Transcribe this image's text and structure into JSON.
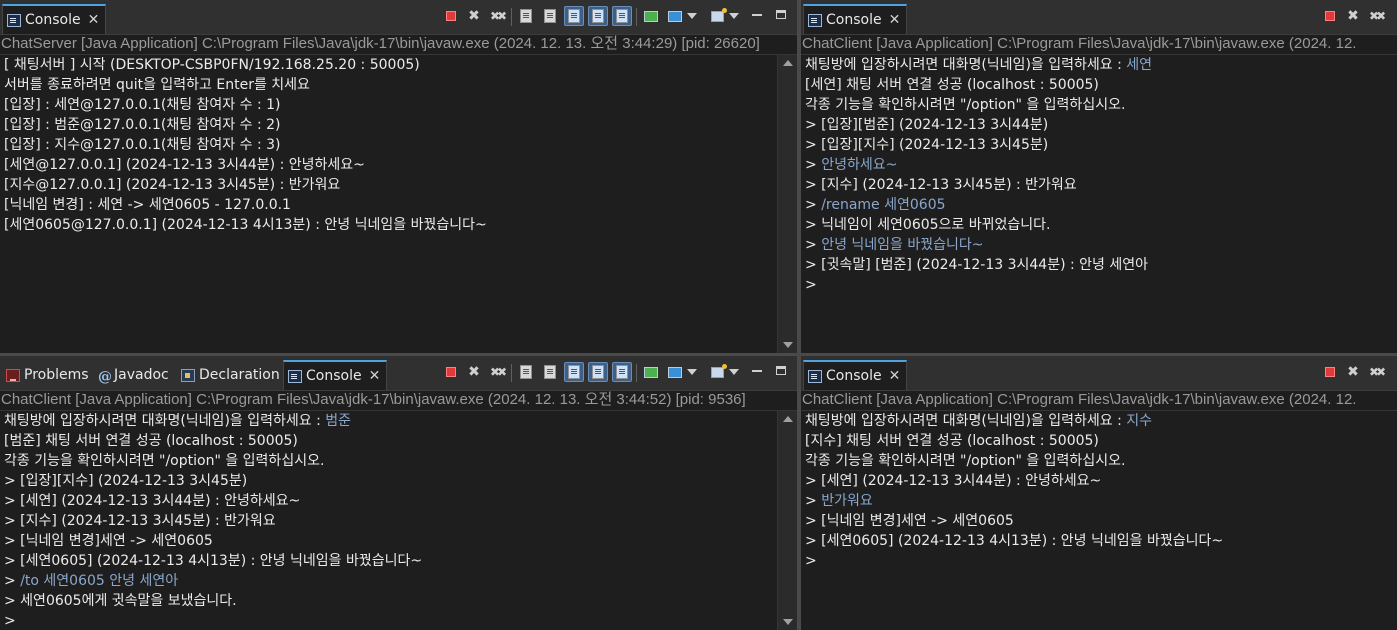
{
  "panes": [
    {
      "tabs": [
        {
          "icon": "console-icon",
          "label": "Console",
          "closable": true,
          "active": true
        }
      ],
      "description": "ChatServer [Java Application] C:\\Program Files\\Java\\jdk-17\\bin\\javaw.exe  (2024. 12. 13. 오전 3:44:29) [pid: 26620]",
      "lines": [
        {
          "prefix": "[ 채팅서버 ] 시작 (DESKTOP-CSBP0FN/192.168.25.20 : 50005)",
          "input": ""
        },
        {
          "prefix": "서버를 종료하려면 quit을 입력하고 Enter를 치세요",
          "input": ""
        },
        {
          "prefix": "[입장] : 세연@127.0.0.1(채팅 참여자 수 : 1)",
          "input": ""
        },
        {
          "prefix": "[입장] : 범준@127.0.0.1(채팅 참여자 수 : 2)",
          "input": ""
        },
        {
          "prefix": "[입장] : 지수@127.0.0.1(채팅 참여자 수 : 3)",
          "input": ""
        },
        {
          "prefix": "[세연@127.0.0.1] (2024-12-13 3시44분) : 안녕하세요~",
          "input": ""
        },
        {
          "prefix": "[지수@127.0.0.1] (2024-12-13 3시45분) : 반가워요",
          "input": ""
        },
        {
          "prefix": "[닉네임 변경] : 세연 -> 세연0605 - 127.0.0.1",
          "input": ""
        },
        {
          "prefix": "[세연0605@127.0.0.1] (2024-12-13 4시13분) : 안녕 닉네임을 바꿨습니다~",
          "input": ""
        }
      ]
    },
    {
      "tabs": [
        {
          "icon": "console-icon",
          "label": "Console",
          "closable": true,
          "active": true
        }
      ],
      "description": "ChatClient [Java Application] C:\\Program Files\\Java\\jdk-17\\bin\\javaw.exe  (2024. 12.",
      "lines": [
        {
          "prefix": "채팅방에 입장하시려면 대화명(닉네임)을 입력하세요 : ",
          "input": "세연"
        },
        {
          "prefix": "[세연] 채팅 서버 연결 성공 (localhost : 50005)",
          "input": ""
        },
        {
          "prefix": "각종 기능을 확인하시려면 \"/option\" 을 입력하십시오.",
          "input": ""
        },
        {
          "prefix": "> [입장][범준] (2024-12-13 3시44분)",
          "input": ""
        },
        {
          "prefix": "> [입장][지수] (2024-12-13 3시45분)",
          "input": ""
        },
        {
          "prefix": "> ",
          "input": "안녕하세요~"
        },
        {
          "prefix": "> [지수] (2024-12-13 3시45분) : 반가워요",
          "input": ""
        },
        {
          "prefix": "> ",
          "input": "/rename 세연0605"
        },
        {
          "prefix": "> 닉네임이 세연0605으로 바뀌었습니다.",
          "input": ""
        },
        {
          "prefix": "> ",
          "input": "안녕 닉네임을 바꿨습니다~"
        },
        {
          "prefix": "> [귓속말] [범준] (2024-12-13 3시44분) : 안녕 세연아",
          "input": ""
        },
        {
          "prefix": ">",
          "input": ""
        }
      ]
    },
    {
      "tabs": [
        {
          "icon": "problems-icon",
          "label": "Problems",
          "closable": false,
          "active": false
        },
        {
          "icon": "javadoc-icon",
          "label": "Javadoc",
          "closable": false,
          "active": false
        },
        {
          "icon": "declaration-icon",
          "label": "Declaration",
          "closable": false,
          "active": false
        },
        {
          "icon": "console-icon",
          "label": "Console",
          "closable": true,
          "active": true
        }
      ],
      "description": "ChatClient [Java Application] C:\\Program Files\\Java\\jdk-17\\bin\\javaw.exe  (2024. 12. 13. 오전 3:44:52) [pid: 9536]",
      "lines": [
        {
          "prefix": "채팅방에 입장하시려면 대화명(닉네임)을 입력하세요 : ",
          "input": "범준"
        },
        {
          "prefix": "[범준] 채팅 서버 연결 성공 (localhost : 50005)",
          "input": ""
        },
        {
          "prefix": "각종 기능을 확인하시려면 \"/option\" 을 입력하십시오.",
          "input": ""
        },
        {
          "prefix": "> [입장][지수] (2024-12-13 3시45분)",
          "input": ""
        },
        {
          "prefix": "> [세연] (2024-12-13 3시44분) : 안녕하세요~",
          "input": ""
        },
        {
          "prefix": "> [지수] (2024-12-13 3시45분) : 반가워요",
          "input": ""
        },
        {
          "prefix": "> [닉네임 변경]세연 -> 세연0605",
          "input": ""
        },
        {
          "prefix": "> [세연0605] (2024-12-13 4시13분) : 안녕 닉네임을 바꿨습니다~",
          "input": ""
        },
        {
          "prefix": "> ",
          "input": "/to 세연0605 안녕 세연아"
        },
        {
          "prefix": "> 세연0605에게 귓속말을 보냈습니다.",
          "input": ""
        },
        {
          "prefix": ">",
          "input": ""
        }
      ]
    },
    {
      "tabs": [
        {
          "icon": "console-icon",
          "label": "Console",
          "closable": true,
          "active": true
        }
      ],
      "description": "ChatClient [Java Application] C:\\Program Files\\Java\\jdk-17\\bin\\javaw.exe  (2024. 12.",
      "lines": [
        {
          "prefix": "채팅방에 입장하시려면 대화명(닉네임)을 입력하세요 : ",
          "input": "지수"
        },
        {
          "prefix": "[지수] 채팅 서버 연결 성공 (localhost : 50005)",
          "input": ""
        },
        {
          "prefix": "각종 기능을 확인하시려면 \"/option\" 을 입력하십시오.",
          "input": ""
        },
        {
          "prefix": "> [세연] (2024-12-13 3시44분) : 안녕하세요~",
          "input": ""
        },
        {
          "prefix": "> ",
          "input": "반가워요"
        },
        {
          "prefix": "> [닉네임 변경]세연 -> 세연0605",
          "input": ""
        },
        {
          "prefix": "> [세연0605] (2024-12-13 4시13분) : 안녕 닉네임을 바꿨습니다~",
          "input": ""
        },
        {
          "prefix": ">",
          "input": ""
        }
      ]
    }
  ],
  "toolbar_icons": {
    "full": [
      "terminate-icon",
      "remove-launch-icon",
      "remove-all-terminated-icon",
      "clear-console-icon",
      "scroll-lock-icon",
      "word-wrap-icon",
      "show-on-stdout-icon",
      "show-on-stderr-icon",
      "pin-console-icon",
      "display-console-icon",
      "open-console-icon",
      "minimize-icon",
      "maximize-icon"
    ],
    "compact": [
      "terminate-icon",
      "remove-launch-icon",
      "remove-all-terminated-icon"
    ]
  },
  "colors": {
    "background": "#1e1e1e",
    "text": "#ebebeb",
    "input": "#8aa7cc",
    "description": "#9a9a9a",
    "active_tab_accent": "#4ea3e0"
  }
}
